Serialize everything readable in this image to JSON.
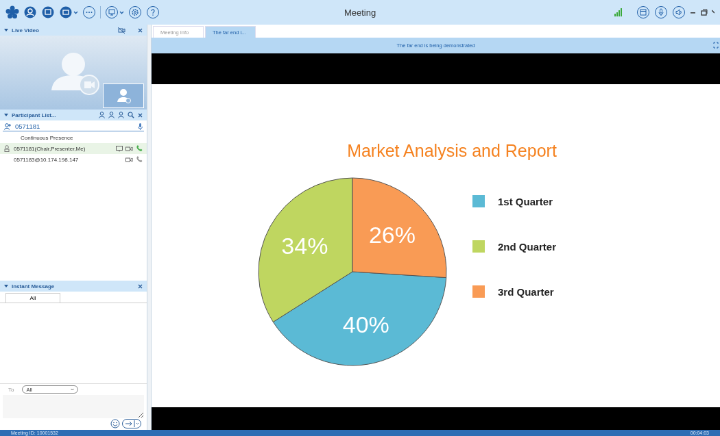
{
  "window": {
    "title": "Meeting"
  },
  "live_video": {
    "title": "Live Video"
  },
  "participant_list": {
    "title": "Participant List...",
    "search": {
      "value": "0571181"
    },
    "layout": "Continuous Presence",
    "participants": [
      {
        "name": "0571181(Chair,Presenter,Me)",
        "selected": true,
        "presenter": true
      },
      {
        "name": "0571183@10.174.198.147",
        "selected": false,
        "presenter": false
      }
    ]
  },
  "instant_message": {
    "title": "Instant Message",
    "tabs": [
      {
        "label": "All",
        "selected": true
      }
    ],
    "to_label": "To",
    "to_value": "All"
  },
  "tabs": [
    {
      "label": "Meeting Info",
      "selected": false
    },
    {
      "label": "The far end i...",
      "selected": true
    }
  ],
  "banner": "The far end is being demonstrated",
  "slide": {
    "chart_data": {
      "type": "pie",
      "title": "Market Analysis and Report",
      "categories": [
        "1st Quarter",
        "2nd Quarter",
        "3rd Quarter"
      ],
      "values": [
        40,
        34,
        26
      ],
      "legend": "right",
      "colors": [
        "#5bbad5",
        "#bfd660",
        "#f99b55"
      ],
      "value_labels": [
        "40%",
        "34%",
        "26%"
      ]
    }
  },
  "status_bar": {
    "meeting_id": "Meeting ID: 10001532",
    "elapsed": "00:04:03"
  }
}
